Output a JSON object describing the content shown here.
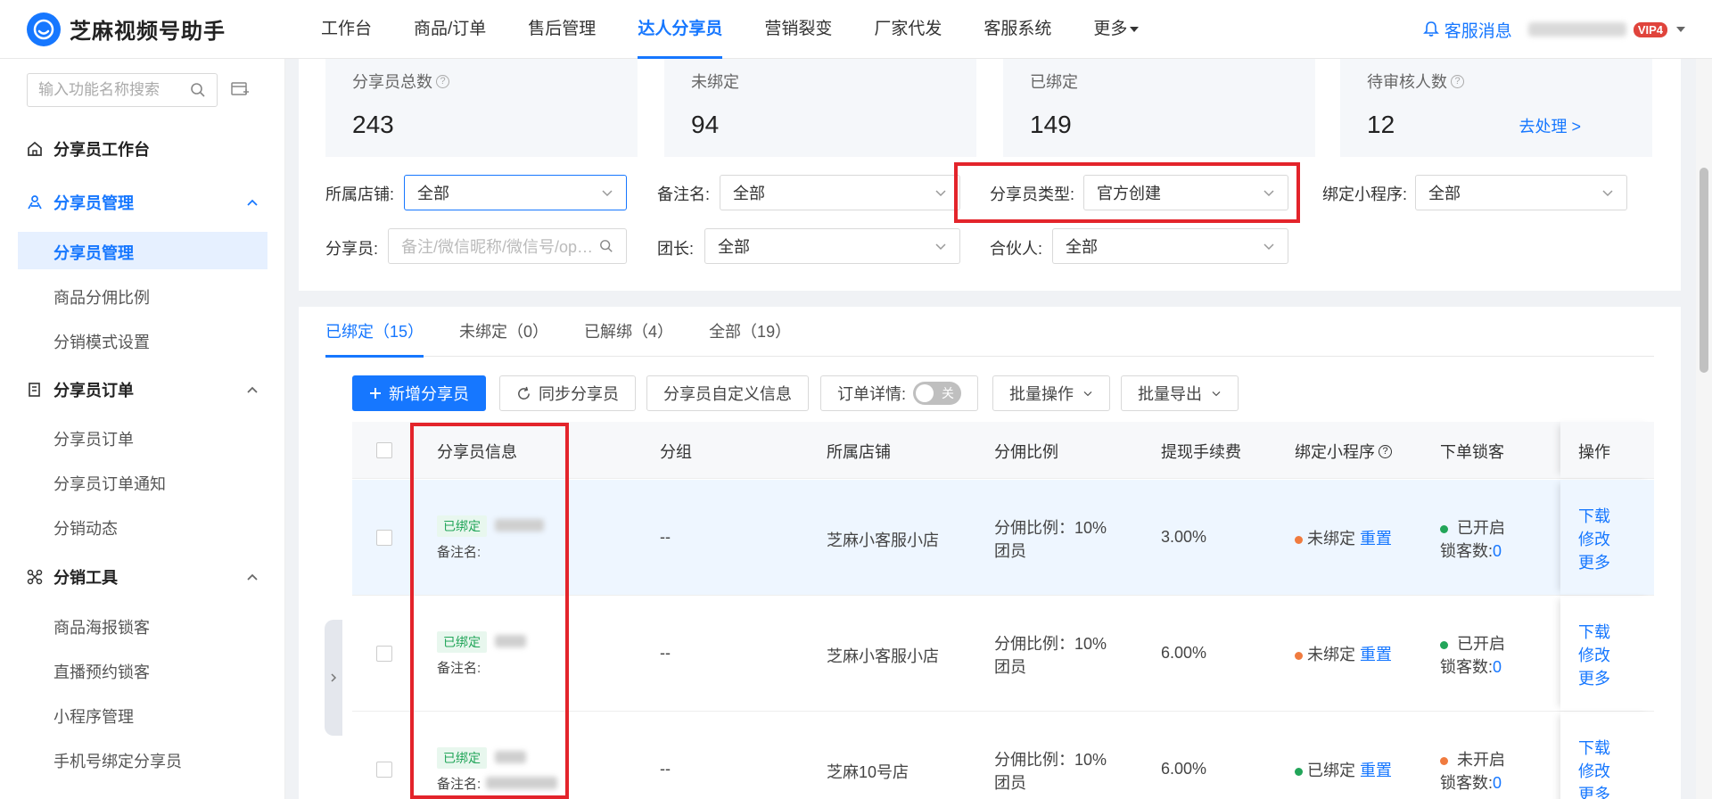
{
  "header": {
    "app_name": "芝麻视频号助手",
    "nav": [
      "工作台",
      "商品/订单",
      "售后管理",
      "达人分享员",
      "营销裂变",
      "厂家代发",
      "客服系统"
    ],
    "nav_more": "更多",
    "message": "客服消息",
    "vip_badge": "VIP4"
  },
  "sidebar": {
    "search_placeholder": "输入功能名称搜索",
    "workbench": "分享员工作台",
    "groups": [
      {
        "title": "分享员管理",
        "items": [
          "分享员管理",
          "商品分佣比例",
          "分销模式设置"
        ]
      },
      {
        "title": "分享员订单",
        "items": [
          "分享员订单",
          "分享员订单通知",
          "分销动态"
        ]
      },
      {
        "title": "分销工具",
        "items": [
          "商品海报锁客",
          "直播预约锁客",
          "小程序管理",
          "手机号绑定分享员"
        ]
      }
    ]
  },
  "stats": [
    {
      "label": "分享员总数",
      "value": "243"
    },
    {
      "label": "未绑定",
      "value": "94"
    },
    {
      "label": "已绑定",
      "value": "149"
    },
    {
      "label": "待审核人数",
      "value": "12",
      "action": "去处理 >"
    }
  ],
  "filters": {
    "store_label": "所属店铺:",
    "store_value": "全部",
    "remark_label": "备注名:",
    "remark_value": "全部",
    "type_label": "分享员类型:",
    "type_value": "官方创建",
    "mini_label": "绑定小程序:",
    "mini_value": "全部",
    "sharer_label": "分享员:",
    "sharer_placeholder": "备注/微信昵称/微信号/op…",
    "leader_label": "团长:",
    "leader_value": "全部",
    "partner_label": "合伙人:",
    "partner_value": "全部"
  },
  "tabs": [
    "已绑定（15）",
    "未绑定（0）",
    "已解绑（4）",
    "全部（19）"
  ],
  "toolbar": {
    "add": "新增分享员",
    "sync": "同步分享员",
    "custom": "分享员自定义信息",
    "order_detail": "订单详情:",
    "toggle_text": "关",
    "batch_op": "批量操作",
    "batch_export": "批量导出"
  },
  "table": {
    "headers": [
      "分享员信息",
      "分组",
      "所属店铺",
      "分佣比例",
      "提现手续费",
      "绑定小程序",
      "下单锁客",
      "操作"
    ],
    "rows": [
      {
        "tag": "已绑定",
        "remark": "备注名:",
        "group": "--",
        "store": "芝麻小客服小店",
        "ratio": "分佣比例：10%",
        "role": "团员",
        "fee": "3.00%",
        "mini": "未绑定",
        "mini_action": "重置",
        "lock": "已开启",
        "lock_count_label": "锁客数:",
        "lock_count": "0",
        "ops": [
          "下载",
          "修改",
          "更多"
        ]
      },
      {
        "tag": "已绑定",
        "remark": "备注名:",
        "group": "--",
        "store": "芝麻小客服小店",
        "ratio": "分佣比例：10%",
        "role": "团员",
        "fee": "6.00%",
        "mini": "未绑定",
        "mini_action": "重置",
        "lock": "已开启",
        "lock_count_label": "锁客数:",
        "lock_count": "0",
        "ops": [
          "下载",
          "修改",
          "更多"
        ]
      },
      {
        "tag": "已绑定",
        "remark": "备注名:",
        "group": "--",
        "store": "芝麻10号店",
        "ratio": "分佣比例：10%",
        "role": "团员",
        "fee": "6.00%",
        "mini": "已绑定",
        "mini_action": "重置",
        "lock": "未开启",
        "lock_count_label": "锁客数:",
        "lock_count": "0",
        "ops": [
          "下载",
          "修改",
          "更多"
        ]
      }
    ]
  },
  "colors": {
    "primary": "#1677ff",
    "highlight": "#e3242b",
    "green": "#22a559",
    "orange": "#f07b3f"
  }
}
